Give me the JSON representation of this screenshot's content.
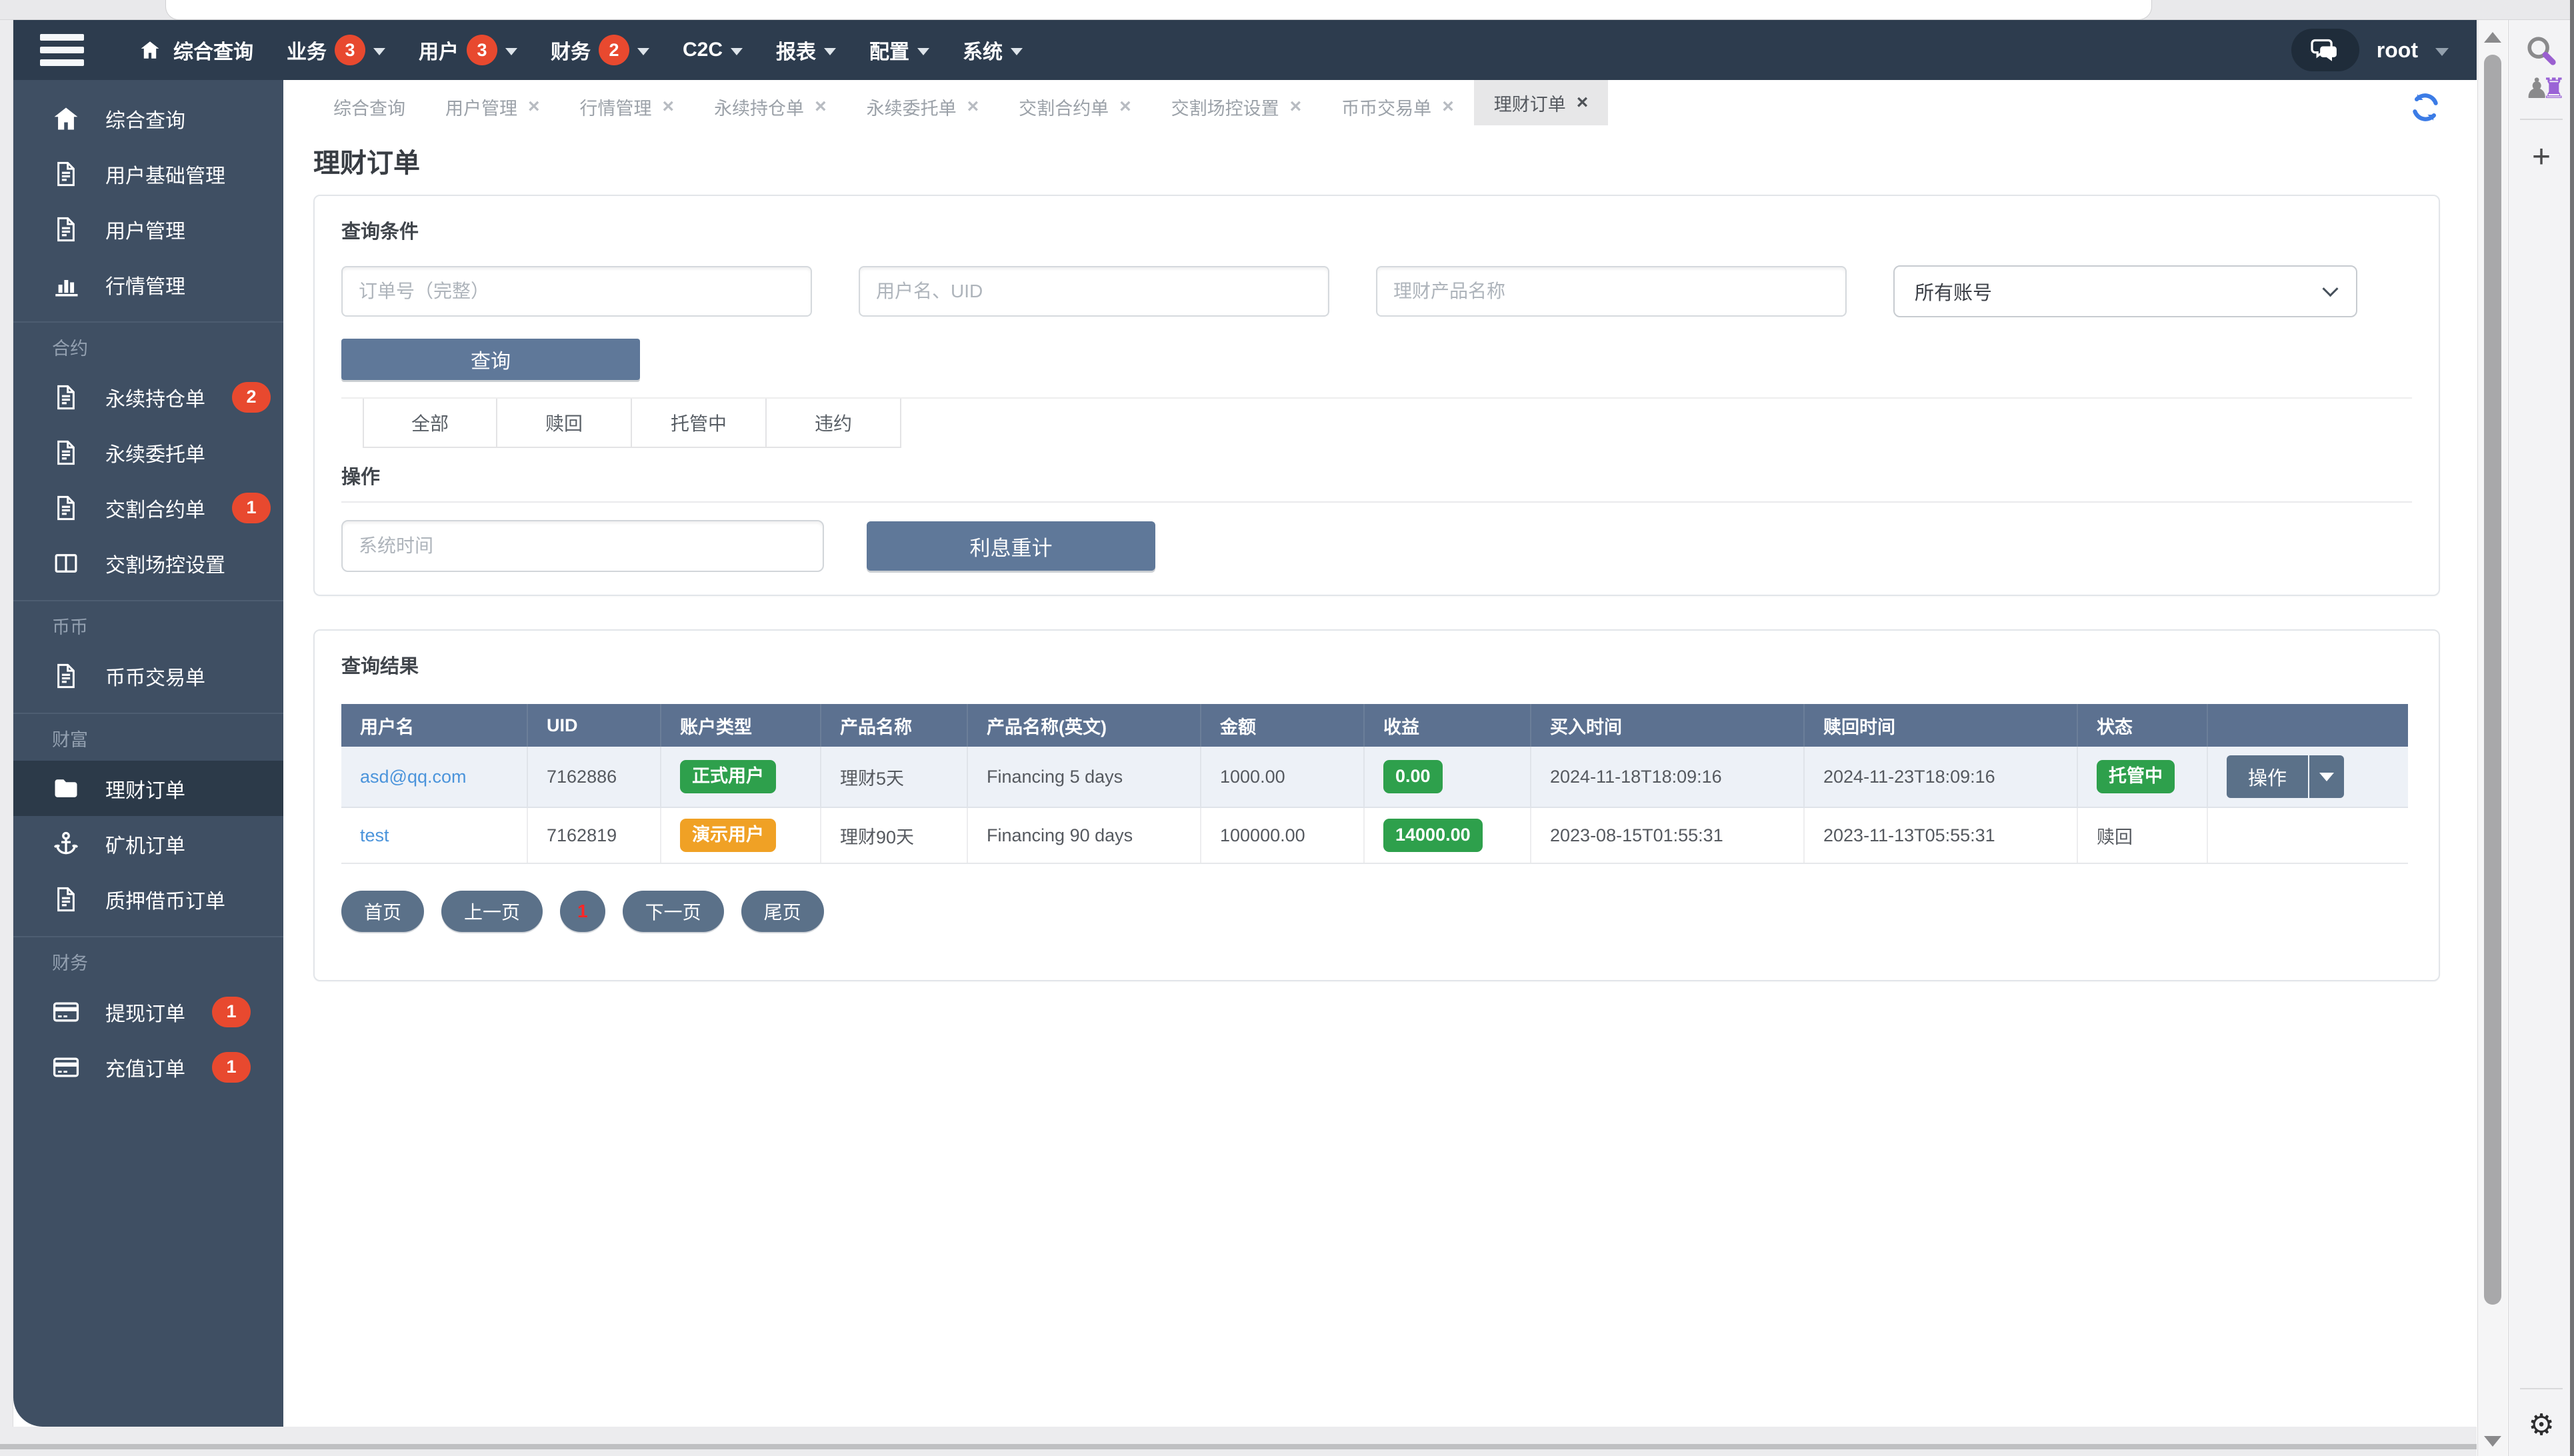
{
  "colors": {
    "navbar_bg": "#2d3c4e",
    "sidebar_bg": "#3f4f63",
    "sidebar_active_bg": "#2c3a49",
    "table_header_bg": "#5c7190",
    "button_bg": "#5f7899",
    "badge_red": "#e8492f",
    "badge_green": "#2ea04c",
    "badge_orange": "#f0a125",
    "link_blue": "#4b94db",
    "refresh_blue": "#3c7ce6"
  },
  "navbar": {
    "home": {
      "label": "综合查询"
    },
    "menus": [
      {
        "label": "业务",
        "badge": "3"
      },
      {
        "label": "用户",
        "badge": "3"
      },
      {
        "label": "财务",
        "badge": "2"
      },
      {
        "label": "C2C"
      },
      {
        "label": "报表"
      },
      {
        "label": "配置"
      },
      {
        "label": "系统"
      }
    ],
    "user": "root"
  },
  "sidebar": {
    "groups": [
      {
        "items": [
          {
            "label": "综合查询",
            "icon": "home-icon"
          },
          {
            "label": "用户基础管理",
            "icon": "document-icon"
          },
          {
            "label": "用户管理",
            "icon": "document-icon"
          },
          {
            "label": "行情管理",
            "icon": "bar-chart-icon"
          }
        ]
      },
      {
        "title": "合约",
        "items": [
          {
            "label": "永续持仓单",
            "icon": "document-icon",
            "badge": "2"
          },
          {
            "label": "永续委托单",
            "icon": "document-icon"
          },
          {
            "label": "交割合约单",
            "icon": "document-icon",
            "badge": "1"
          },
          {
            "label": "交割场控设置",
            "icon": "columns-icon"
          }
        ]
      },
      {
        "title": "币币",
        "items": [
          {
            "label": "币币交易单",
            "icon": "document-icon"
          }
        ]
      },
      {
        "title": "财富",
        "items": [
          {
            "label": "理财订单",
            "icon": "folder-icon",
            "active": true
          },
          {
            "label": "矿机订单",
            "icon": "anchor-icon"
          },
          {
            "label": "质押借币订单",
            "icon": "document-icon"
          }
        ]
      },
      {
        "title": "财务",
        "items": [
          {
            "label": "提现订单",
            "icon": "credit-card-icon",
            "badge": "1"
          },
          {
            "label": "充值订单",
            "icon": "credit-card-icon",
            "badge": "1"
          }
        ]
      }
    ]
  },
  "tabs": [
    {
      "label": "综合查询"
    },
    {
      "label": "用户管理",
      "close": "×"
    },
    {
      "label": "行情管理",
      "close": "×"
    },
    {
      "label": "永续持仓单",
      "close": "×"
    },
    {
      "label": "永续委托单",
      "close": "×"
    },
    {
      "label": "交割合约单",
      "close": "×"
    },
    {
      "label": "交割场控设置",
      "close": "×"
    },
    {
      "label": "币币交易单",
      "close": "×"
    },
    {
      "label": "理财订单",
      "close": "×",
      "active": true
    }
  ],
  "page": {
    "title": "理财订单"
  },
  "query": {
    "section_title": "查询条件",
    "inputs": [
      {
        "placeholder": "订单号（完整）"
      },
      {
        "placeholder": "用户名、UID"
      },
      {
        "placeholder": "理财产品名称"
      }
    ],
    "account_select": "所有账号",
    "search_button": "查询",
    "filter_tabs": [
      "全部",
      "赎回",
      "托管中",
      "违约"
    ]
  },
  "operation": {
    "section_title": "操作",
    "time_placeholder": "系统时间",
    "recalc_button": "利息重计"
  },
  "results": {
    "section_title": "查询结果",
    "columns": [
      "用户名",
      "UID",
      "账户类型",
      "产品名称",
      "产品名称(英文)",
      "金额",
      "收益",
      "买入时间",
      "赎回时间",
      "状态",
      ""
    ],
    "rows": [
      {
        "username": "asd@qq.com",
        "uid": "7162886",
        "account_type": "正式用户",
        "product": "理财5天",
        "product_en": "Financing 5 days",
        "amount": "1000.00",
        "profit": "0.00",
        "buy_time": "2024-11-18T18:09:16",
        "redeem_time": "2024-11-23T18:09:16",
        "status": "托管中",
        "action": "操作"
      },
      {
        "username": "test",
        "uid": "7162819",
        "account_type": "演示用户",
        "product": "理财90天",
        "product_en": "Financing 90 days",
        "amount": "100000.00",
        "profit": "14000.00",
        "buy_time": "2023-08-15T01:55:31",
        "redeem_time": "2023-11-13T05:55:31",
        "status": "赎回"
      }
    ],
    "pagination": {
      "first": "首页",
      "prev": "上一页",
      "current": "1",
      "next": "下一页",
      "last": "尾页"
    }
  }
}
